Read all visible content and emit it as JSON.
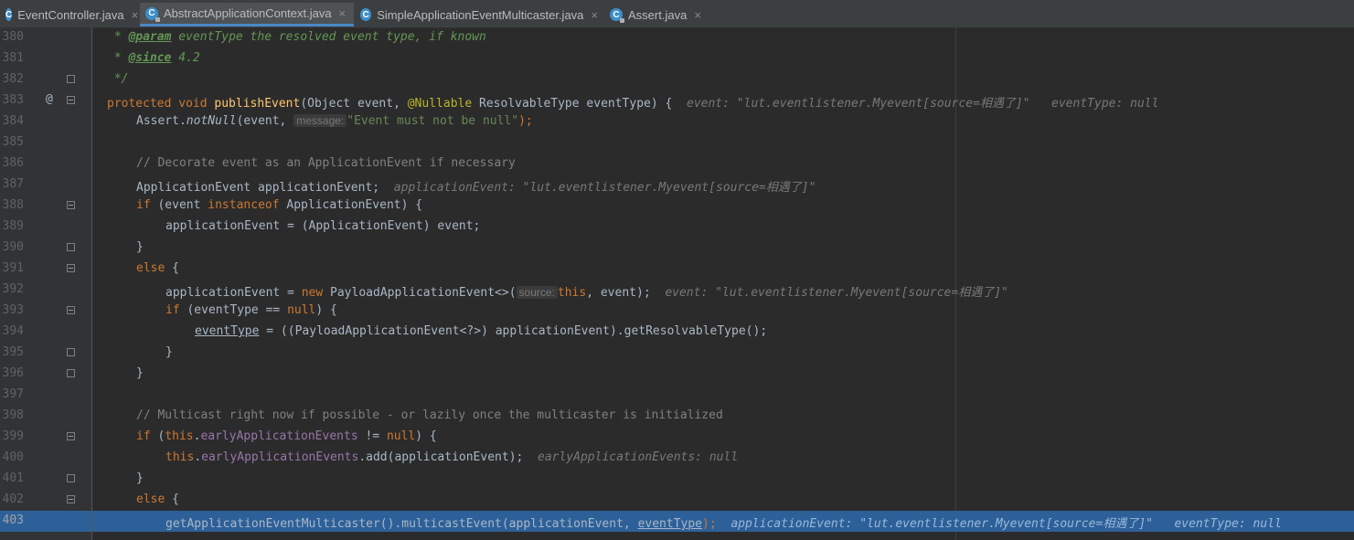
{
  "tabs": [
    {
      "label": "EventController.java",
      "icon": "java-class-icon"
    },
    {
      "label": "AbstractApplicationContext.java",
      "icon": "abstract-class-icon",
      "active": true
    },
    {
      "label": "SimpleApplicationEventMulticaster.java",
      "icon": "java-class-icon"
    },
    {
      "label": "Assert.java",
      "icon": "abstract-class-icon"
    }
  ],
  "close_glyph": "×",
  "line_numbers": [
    "380",
    "381",
    "382",
    "383",
    "384",
    "385",
    "386",
    "387",
    "388",
    "389",
    "390",
    "391",
    "392",
    "393",
    "394",
    "395",
    "396",
    "397",
    "398",
    "399",
    "400",
    "401",
    "402",
    "403"
  ],
  "gutter_marks": {
    "override": "@"
  },
  "code": {
    "l380_a": " * ",
    "l380_tag": "@param",
    "l380_b": " eventType the resolved event type, if known",
    "l381_a": " * ",
    "l381_tag": "@since",
    "l381_b": " 4.2",
    "l382": " */",
    "l383_kw": "protected void ",
    "l383_fn": "publishEvent",
    "l383_a": "(Object event, ",
    "l383_an": "@Nullable",
    "l383_b": " ResolvableType eventType) {",
    "l383_dbg": "event: \"lut.eventlistener.Myevent[source=相遇了]\"   eventType: null",
    "l384_a": "Assert.",
    "l384_it": "notNull",
    "l384_b": "(event, ",
    "l384_hint": "message:",
    "l384_str": "\"Event must not be null\"",
    "l384_c": ");",
    "l386": "// Decorate event as an ApplicationEvent if necessary",
    "l387_a": "ApplicationEvent applicationEvent;",
    "l387_dbg": "applicationEvent: \"lut.eventlistener.Myevent[source=相遇了]\"",
    "l388_kw1": "if",
    "l388_a": " (event ",
    "l388_kw2": "instanceof",
    "l388_b": " ApplicationEvent) {",
    "l389_a": "applicationEvent = (ApplicationEvent) event;",
    "l390": "}",
    "l391_kw": "else",
    "l391_a": " {",
    "l392_a": "applicationEvent = ",
    "l392_kw": "new",
    "l392_b": " PayloadApplicationEvent<>(",
    "l392_hint": "source:",
    "l392_kw2": "this",
    "l392_c": ", event);",
    "l392_dbg": "event: \"lut.eventlistener.Myevent[source=相遇了]\"",
    "l393_kw": "if",
    "l393_a": " (eventType == ",
    "l393_kw2": "null",
    "l393_b": ") {",
    "l394_ul": "eventType",
    "l394_a": " = ((PayloadApplicationEvent<?>) applicationEvent).getResolvableType();",
    "l395": "}",
    "l396": "}",
    "l398": "// Multicast right now if possible - or lazily once the multicaster is initialized",
    "l399_kw": "if",
    "l399_a": " (",
    "l399_kw2": "this",
    "l399_dot": ".",
    "l399_fld": "earlyApplicationEvents",
    "l399_b": " != ",
    "l399_kw3": "null",
    "l399_c": ") {",
    "l400_kw": "this",
    "l400_dot": ".",
    "l400_fld": "earlyApplicationEvents",
    "l400_a": ".add(applicationEvent);",
    "l400_dbg": "earlyApplicationEvents: null",
    "l401": "}",
    "l402_kw": "else",
    "l402_a": " {",
    "l403_a": "getApplicationEventMulticaster().multicastEvent(applicationEvent, ",
    "l403_ul": "eventType",
    "l403_b": ");",
    "l403_dbg": "applicationEvent: \"lut.eventlistener.Myevent[source=相遇了]\"   eventType: null"
  },
  "colors": {
    "background": "#2b2b2b",
    "gutter": "#313335",
    "current_line": "#2d6099",
    "keyword": "#cc7832",
    "string": "#6a8759"
  }
}
